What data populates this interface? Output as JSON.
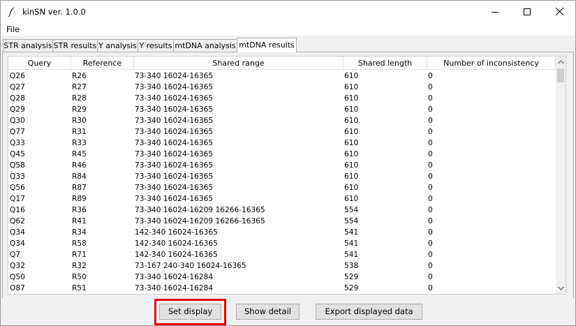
{
  "window": {
    "title": "kinSN ver. 1.0.0"
  },
  "menu": {
    "file": "File"
  },
  "tabs": [
    "STR analysis",
    "STR results",
    "Y analysis",
    "Y results",
    "mtDNA analysis",
    "mtDNA results"
  ],
  "active_tab": "mtDNA results",
  "table": {
    "columns": [
      "Query",
      "Reference",
      "Shared range",
      "Shared length",
      "Number of inconsistency"
    ],
    "rows": [
      [
        "Q26",
        "R26",
        "73-340 16024-16365",
        "610",
        "0"
      ],
      [
        "Q27",
        "R27",
        "73-340 16024-16365",
        "610",
        "0"
      ],
      [
        "Q28",
        "R28",
        "73-340 16024-16365",
        "610",
        "0"
      ],
      [
        "Q29",
        "R29",
        "73-340 16024-16365",
        "610",
        "0"
      ],
      [
        "Q30",
        "R30",
        "73-340 16024-16365",
        "610",
        "0"
      ],
      [
        "Q77",
        "R31",
        "73-340 16024-16365",
        "610",
        "0"
      ],
      [
        "Q33",
        "R33",
        "73-340 16024-16365",
        "610",
        "0"
      ],
      [
        "Q45",
        "R45",
        "73-340 16024-16365",
        "610",
        "0"
      ],
      [
        "Q58",
        "R46",
        "73-340 16024-16365",
        "610",
        "0"
      ],
      [
        "Q33",
        "R84",
        "73-340 16024-16365",
        "610",
        "0"
      ],
      [
        "Q56",
        "R87",
        "73-340 16024-16365",
        "610",
        "0"
      ],
      [
        "Q17",
        "R89",
        "73-340 16024-16365",
        "610",
        "0"
      ],
      [
        "Q16",
        "R36",
        "73-340 16024-16209 16266-16365",
        "554",
        "0"
      ],
      [
        "Q62",
        "R41",
        "73-340 16024-16209 16266-16365",
        "554",
        "0"
      ],
      [
        "Q34",
        "R34",
        "142-340 16024-16365",
        "541",
        "0"
      ],
      [
        "Q34",
        "R58",
        "142-340 16024-16365",
        "541",
        "0"
      ],
      [
        "Q7",
        "R71",
        "142-340 16024-16365",
        "541",
        "0"
      ],
      [
        "Q32",
        "R32",
        "73-167 240-340 16024-16365",
        "538",
        "0"
      ],
      [
        "Q50",
        "R50",
        "73-340 16024-16284",
        "529",
        "0"
      ],
      [
        "O87",
        "R51",
        "73-340 16024-16284",
        "529",
        "0"
      ]
    ]
  },
  "buttons": {
    "set_display": "Set display",
    "show_detail": "Show detail",
    "export": "Export displayed data"
  },
  "colors": {
    "highlight": "#e00018"
  }
}
